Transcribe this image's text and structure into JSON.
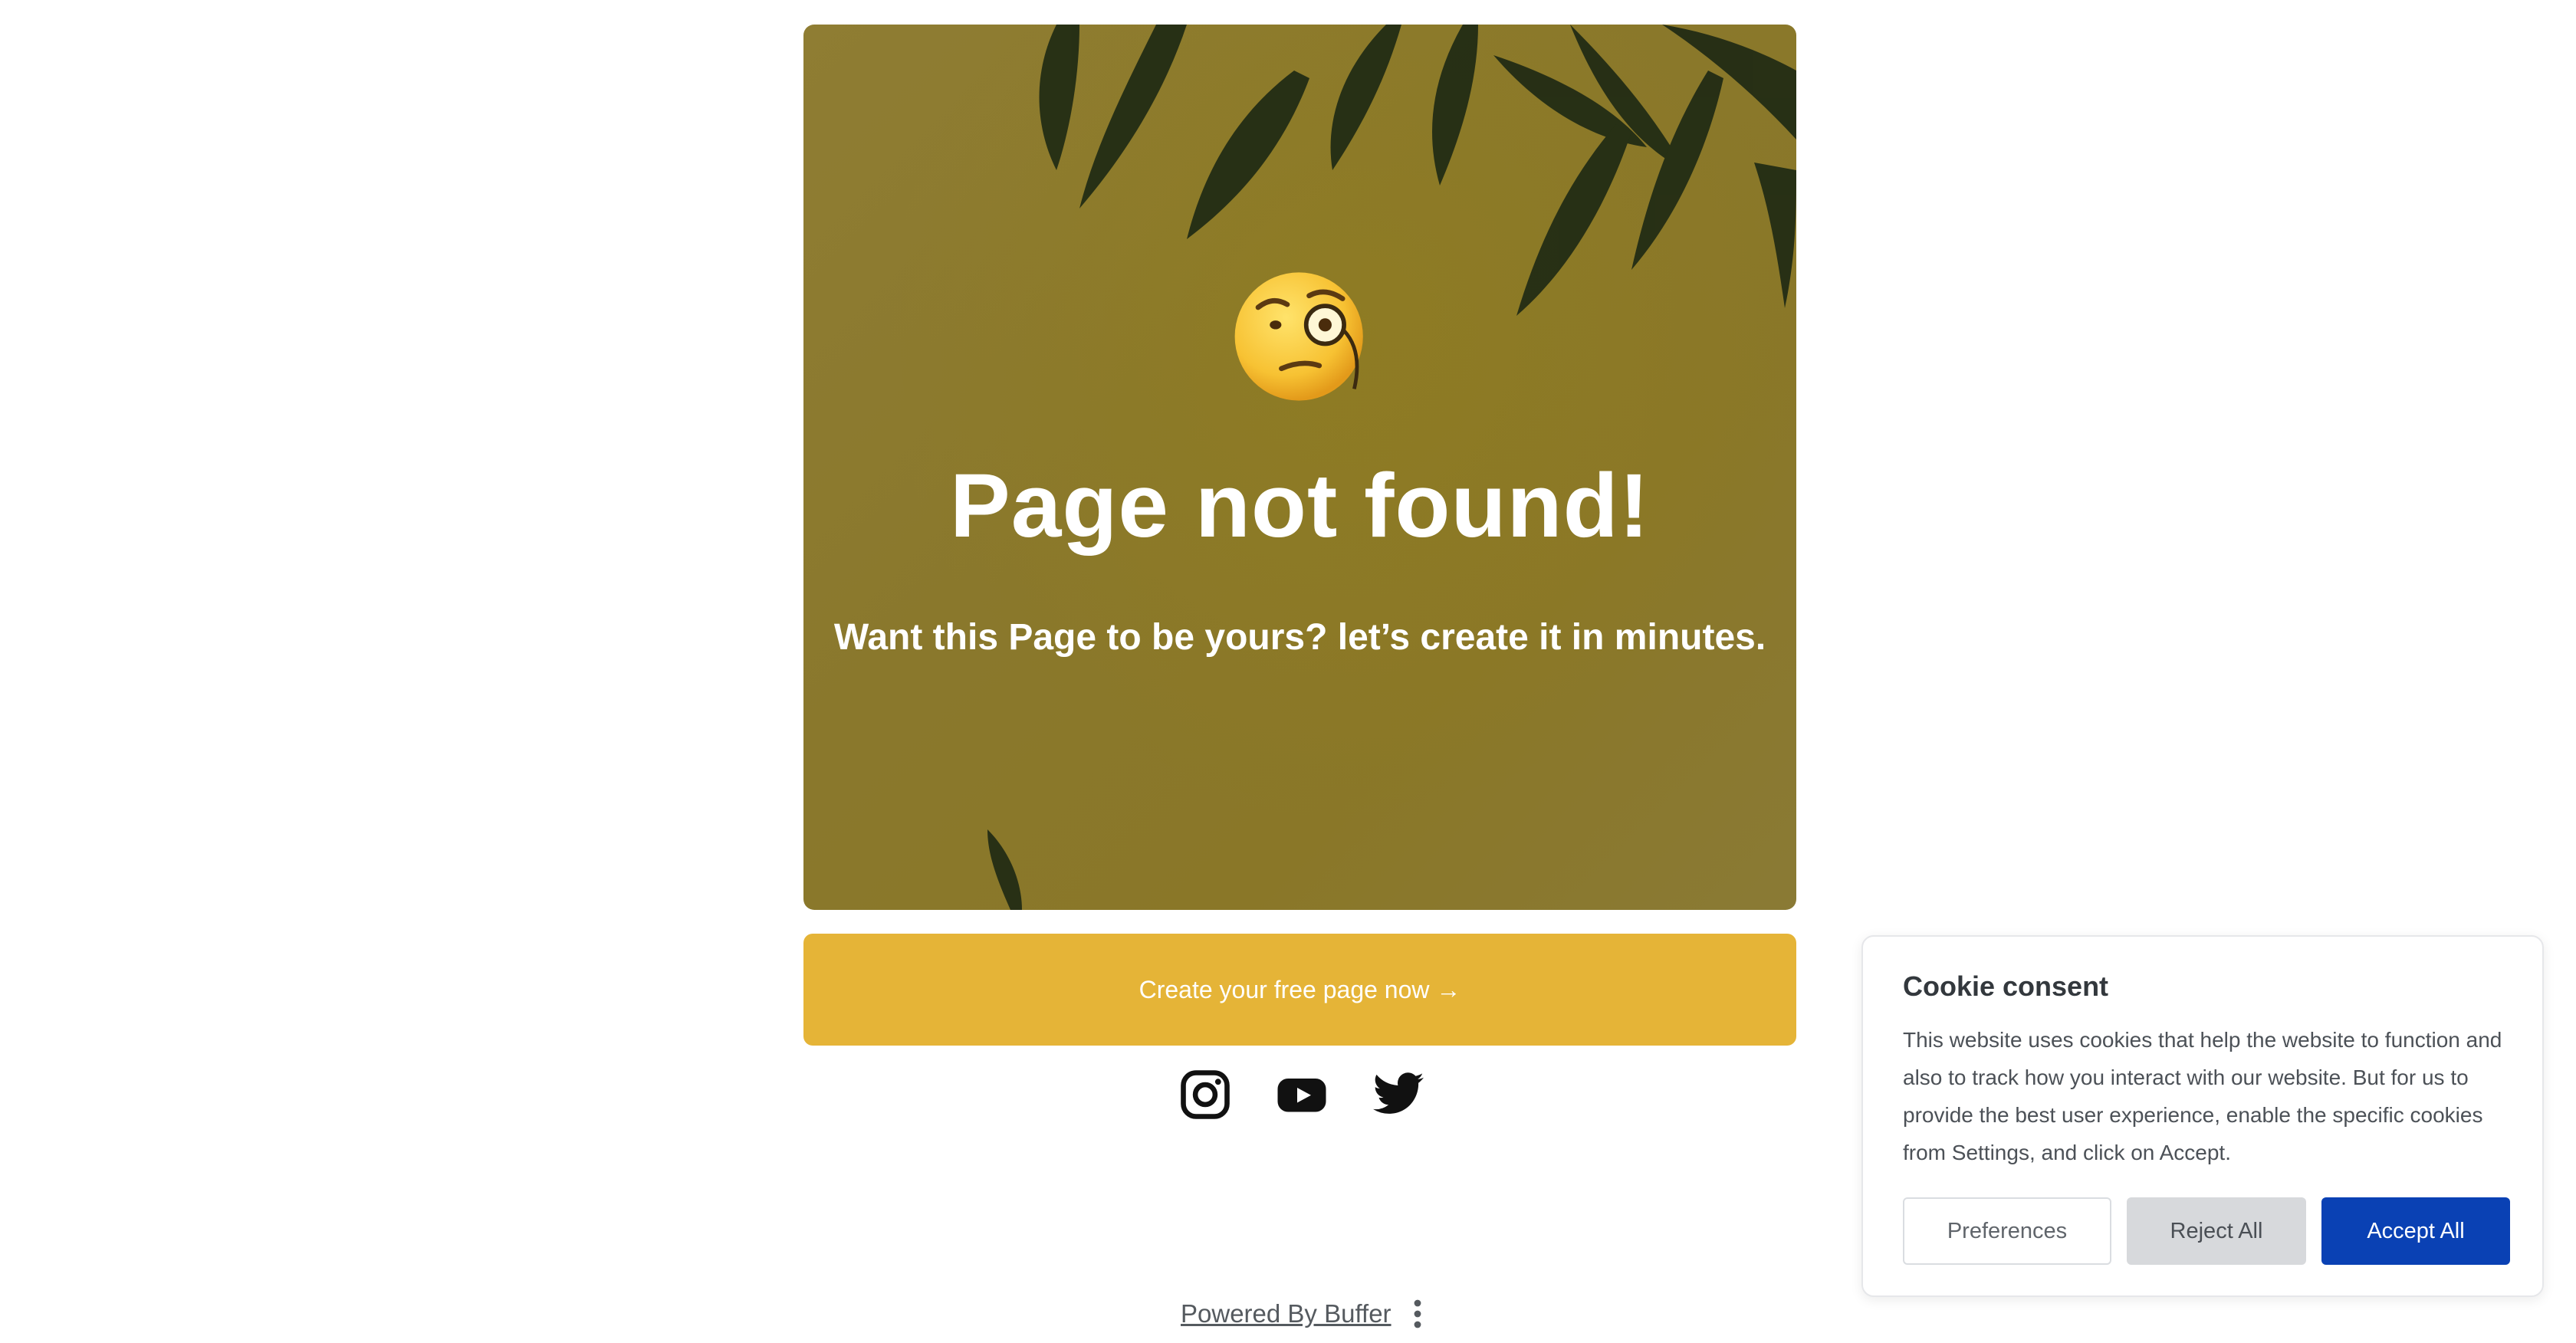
{
  "hero": {
    "title": "Page not found!",
    "subtitle": "Want this Page to be yours? let’s create it in minutes.",
    "emoji": "face-with-monocle",
    "background_color": "#8a7a2e"
  },
  "cta": {
    "label": "Create your free page now →",
    "color": "#e5b437"
  },
  "socials": [
    {
      "icon": "instagram-icon"
    },
    {
      "icon": "youtube-icon"
    },
    {
      "icon": "twitter-icon"
    }
  ],
  "footer": {
    "powered_by": "Powered By Buffer",
    "menu_icon": "kebab-menu-icon"
  },
  "cookie_consent": {
    "title": "Cookie consent",
    "body": "This website uses cookies that help the website to function and also to track how you interact with our website. But for us to provide the best user experience, enable the specific cookies from Settings, and click on Accept.",
    "preferences_label": "Preferences",
    "reject_label": "Reject All",
    "accept_label": "Accept All",
    "accept_color": "#0a41b4"
  }
}
